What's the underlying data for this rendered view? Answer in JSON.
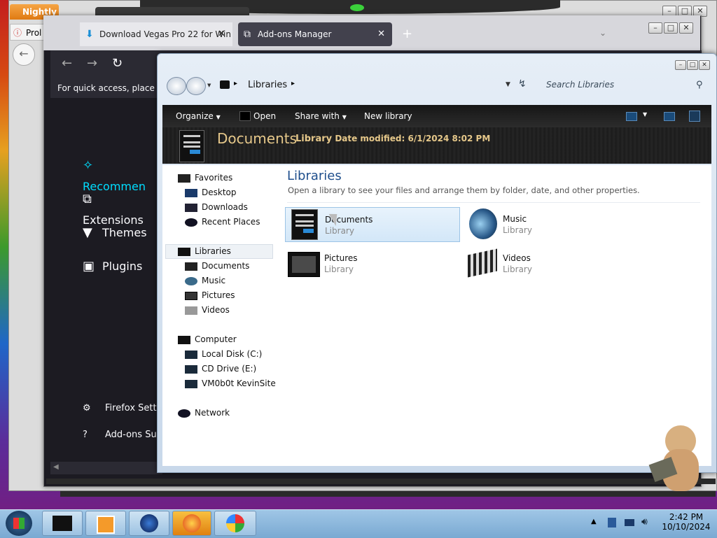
{
  "nightly": {
    "button_label": "Nightly",
    "tab_label": "Prol"
  },
  "firefox": {
    "tabs": [
      {
        "label": "Download Vegas Pro 22 for Win"
      },
      {
        "label": "Add-ons Manager"
      }
    ],
    "quick_access_text": "For quick access, place you",
    "sidebar": {
      "items": [
        {
          "label": "Recommen",
          "icon": "sparkle-icon"
        },
        {
          "label": "Extensions",
          "icon": "puzzle-icon"
        },
        {
          "label": "Themes",
          "icon": "brush-icon"
        },
        {
          "label": "Plugins",
          "icon": "plugin-icon"
        }
      ],
      "bottom": [
        {
          "label": "Firefox Setti",
          "icon": "gear-icon"
        },
        {
          "label": "Add-ons Sup",
          "icon": "help-icon"
        }
      ]
    },
    "accent": "#00ddff"
  },
  "explorer": {
    "address": {
      "crumb": "Libraries"
    },
    "search_placeholder": "Search Libraries",
    "toolbar": {
      "organize": "Organize",
      "open": "Open",
      "share_with": "Share with",
      "new_library": "New library"
    },
    "details": {
      "title": "Documents",
      "type": "Library",
      "date_label": "Date modified:",
      "date_value": "6/1/2024 8:02 PM"
    },
    "nav": {
      "favorites": "Favorites",
      "desktop": "Desktop",
      "downloads": "Downloads",
      "recent_places": "Recent Places",
      "libraries": "Libraries",
      "documents": "Documents",
      "music": "Music",
      "pictures": "Pictures",
      "videos": "Videos",
      "computer": "Computer",
      "local_disk": "Local Disk (C:)",
      "cd_drive": "CD Drive (E:)",
      "site": "VM0b0t KevinSite",
      "network": "Network"
    },
    "main": {
      "heading": "Libraries",
      "subtitle": "Open a library to see your files and arrange them by folder, date, and other properties.",
      "libraries": [
        {
          "name": "Documents",
          "type": "Library"
        },
        {
          "name": "Music",
          "type": "Library"
        },
        {
          "name": "Pictures",
          "type": "Library"
        },
        {
          "name": "Videos",
          "type": "Library"
        }
      ]
    }
  },
  "taskbar": {
    "time": "2:42 PM",
    "date": "10/10/2024"
  }
}
